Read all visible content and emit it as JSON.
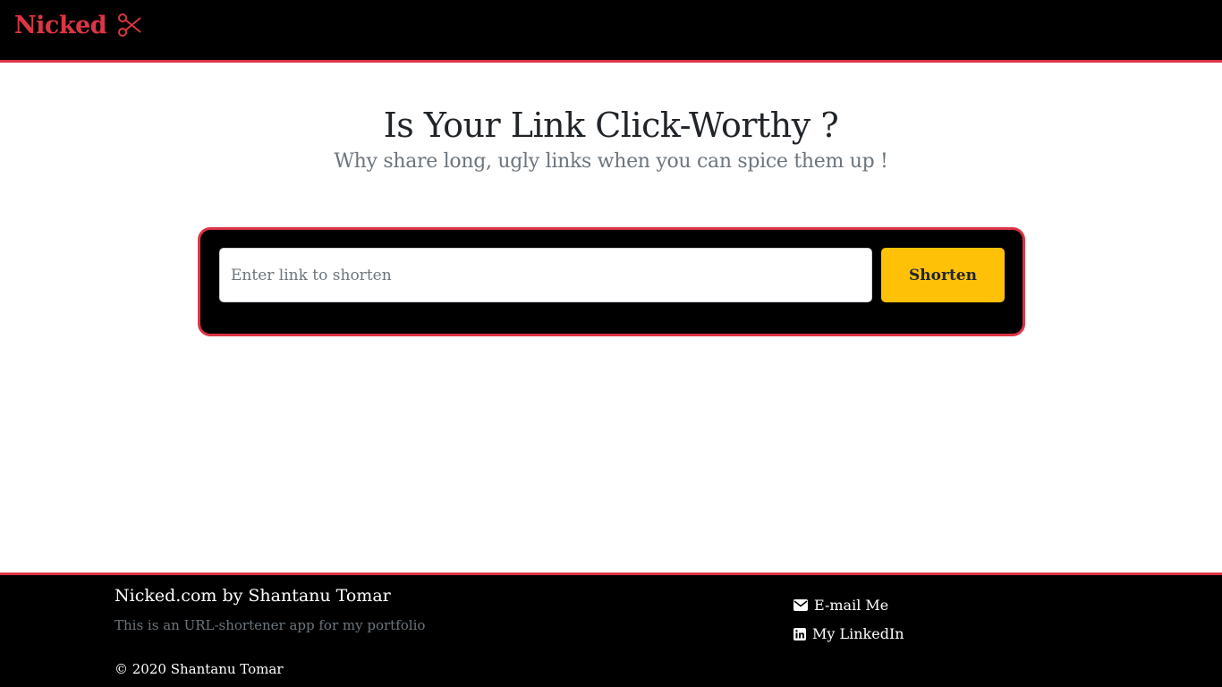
{
  "navbar": {
    "brand": "Nicked",
    "brand_icon": "scissors-icon",
    "brand_color": "#dc3545"
  },
  "hero": {
    "title": "Is Your Link Click-Worthy ?",
    "subtitle": "Why share long, ugly links when you can spice them up !"
  },
  "shortener": {
    "input_value": "",
    "input_placeholder": "Enter link to shorten",
    "button_label": "Shorten",
    "button_color": "#ffc107",
    "border_color": "#dc3545"
  },
  "footer": {
    "title": "Nicked.com by Shantanu Tomar",
    "description": "This is an URL-shortener app for my portfolio",
    "copyright": "© 2020 Shantanu Tomar",
    "links": [
      {
        "label": "E-mail Me",
        "icon": "envelope-icon"
      },
      {
        "label": "My LinkedIn",
        "icon": "linkedin-icon"
      }
    ]
  }
}
